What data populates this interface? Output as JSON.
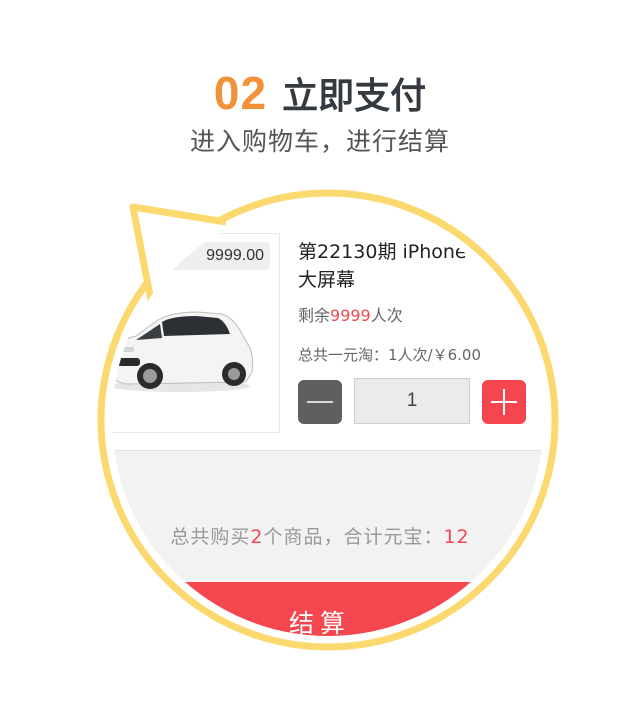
{
  "header": {
    "step_number": "02",
    "step_title": "立即支付",
    "subtitle": "进入购物车，进行结算"
  },
  "product": {
    "price_tag": "9999.00",
    "title_line1": "第22130期 iPhone",
    "title_line2": "大屏幕",
    "remaining_prefix": "剩余",
    "remaining_count": "9999",
    "remaining_suffix": "人次",
    "total_line": "总共一元淘：1人次/￥6.00",
    "quantity": "1"
  },
  "summary": {
    "prefix": "总共购买",
    "item_count": "2",
    "middle": "个商品，合计元宝：",
    "total": "12"
  },
  "checkout": {
    "label": "结算"
  },
  "colors": {
    "accent_orange": "#f2913a",
    "accent_red": "#f5474f",
    "bubble_border": "#fcd96e"
  },
  "icons": {
    "minus": "minus-icon",
    "plus": "plus-icon",
    "car_image": "car-image"
  }
}
